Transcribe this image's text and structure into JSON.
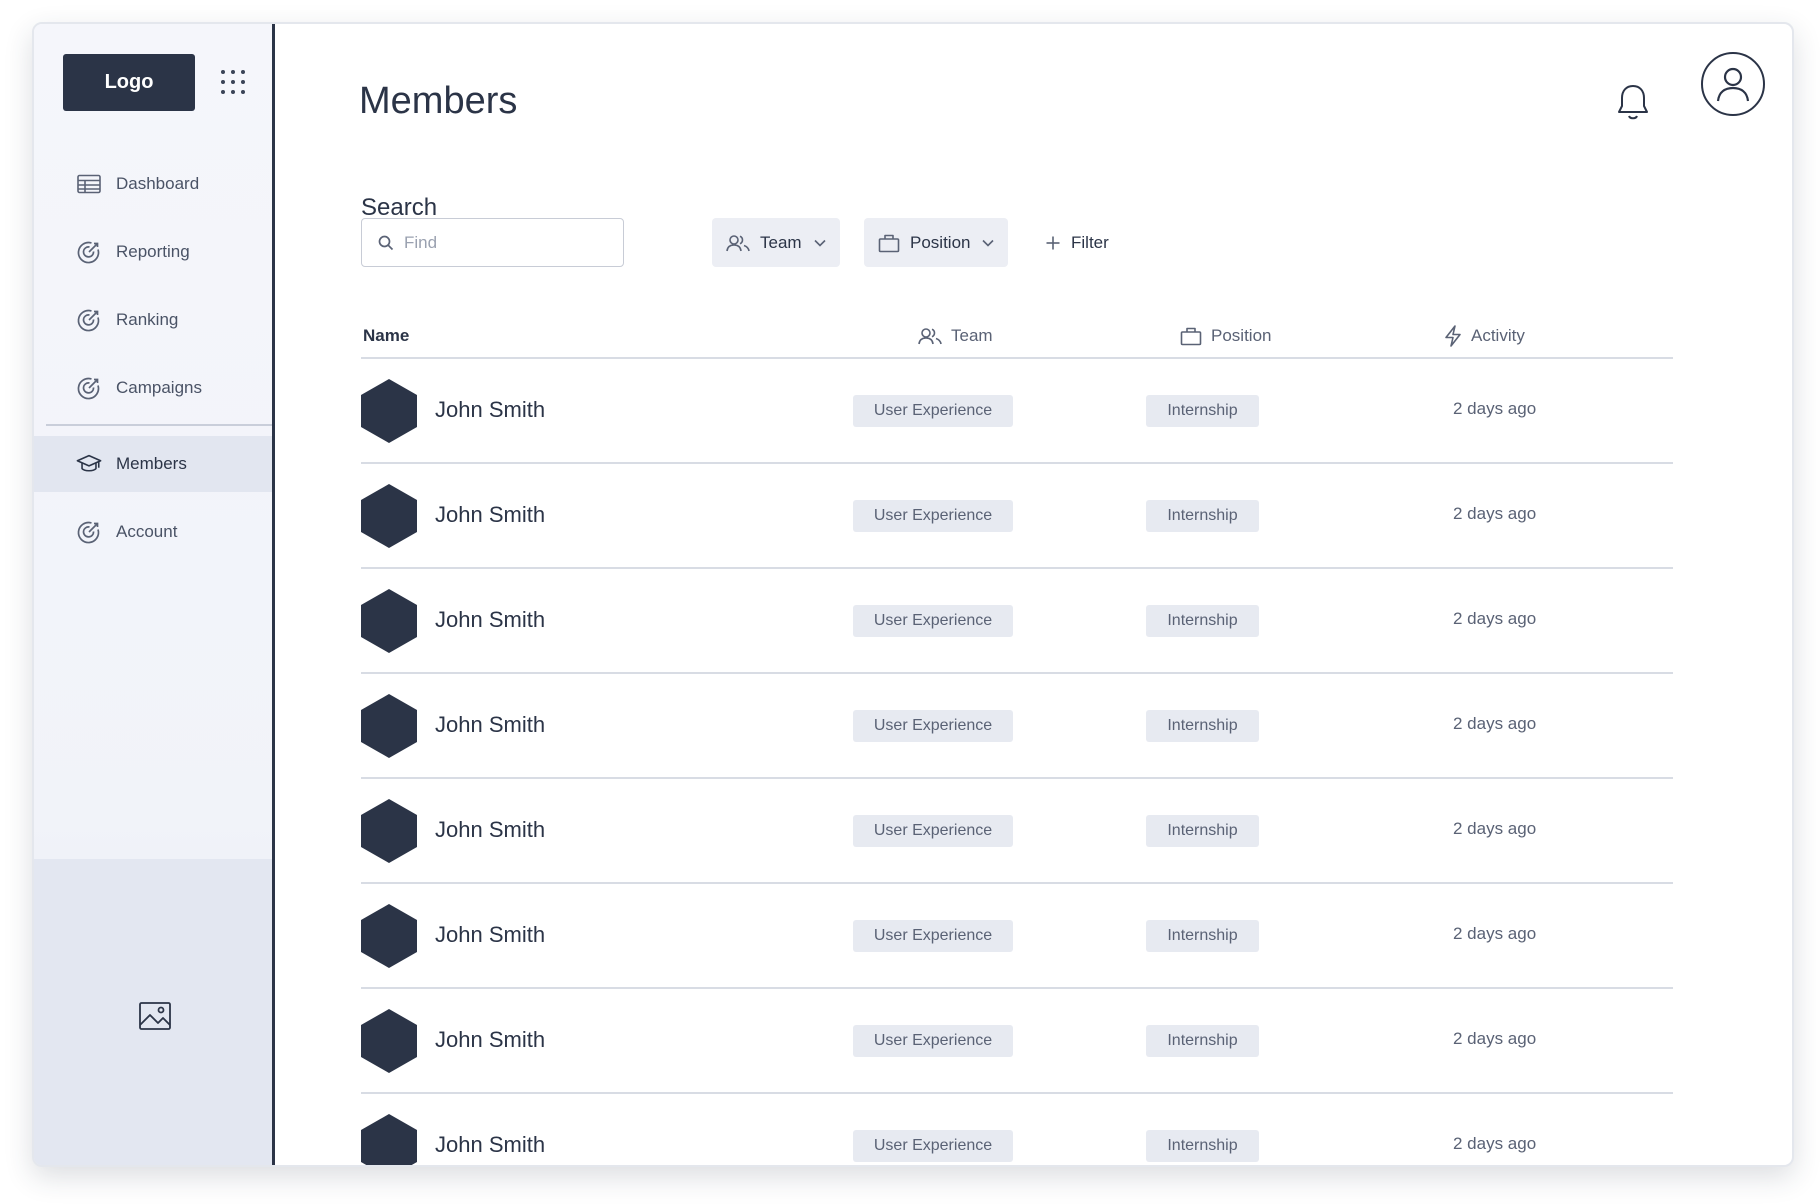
{
  "sidebar": {
    "logo": "Logo",
    "items": [
      {
        "label": "Dashboard",
        "icon": "table-icon",
        "active": false
      },
      {
        "label": "Reporting",
        "icon": "target-icon",
        "active": false
      },
      {
        "label": "Ranking",
        "icon": "target-icon",
        "active": false
      },
      {
        "label": "Campaigns",
        "icon": "target-icon",
        "active": false
      },
      {
        "label": "Members",
        "icon": "graduation-cap-icon",
        "active": true
      },
      {
        "label": "Account",
        "icon": "target-icon",
        "active": false
      }
    ],
    "bottom_icon": "image-icon"
  },
  "header": {
    "title": "Members"
  },
  "search": {
    "label": "Search",
    "placeholder": "Find",
    "value": "",
    "team_filter": "Team",
    "position_filter": "Position",
    "add_filter": "Filter"
  },
  "table": {
    "headers": {
      "name": "Name",
      "team": "Team",
      "position": "Position",
      "activity": "Activity"
    },
    "rows": [
      {
        "name": "John Smith",
        "team": "User Experience",
        "position": "Internship",
        "activity": "2 days ago"
      },
      {
        "name": "John Smith",
        "team": "User Experience",
        "position": "Internship",
        "activity": "2 days ago"
      },
      {
        "name": "John Smith",
        "team": "User Experience",
        "position": "Internship",
        "activity": "2 days ago"
      },
      {
        "name": "John Smith",
        "team": "User Experience",
        "position": "Internship",
        "activity": "2 days ago"
      },
      {
        "name": "John Smith",
        "team": "User Experience",
        "position": "Internship",
        "activity": "2 days ago"
      },
      {
        "name": "John Smith",
        "team": "User Experience",
        "position": "Internship",
        "activity": "2 days ago"
      },
      {
        "name": "John Smith",
        "team": "User Experience",
        "position": "Internship",
        "activity": "2 days ago"
      },
      {
        "name": "John Smith",
        "team": "User Experience",
        "position": "Internship",
        "activity": "2 days ago"
      }
    ]
  },
  "colors": {
    "primary": "#2b3447",
    "sidebar_bg": "#f3f5fa",
    "tag_bg": "#e7eaf1",
    "divider": "#d8dce4"
  }
}
